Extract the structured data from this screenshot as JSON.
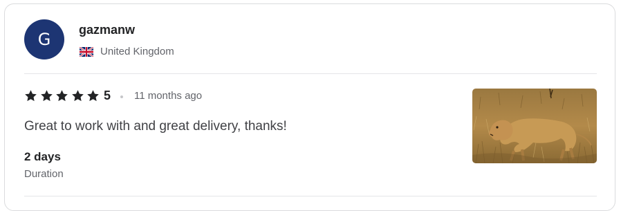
{
  "review": {
    "avatar_initial": "G",
    "username": "gazmanw",
    "country": "United Kingdom",
    "rating": "5",
    "stars_filled": 5,
    "time_ago": "11 months ago",
    "text": "Great to work with and great delivery, thanks!",
    "duration_value": "2 days",
    "duration_label": "Duration"
  },
  "icons": {
    "flag": "uk-flag-icon",
    "star": "star-icon"
  },
  "colors": {
    "avatar_bg": "#1d3573",
    "text_dark": "#222325",
    "text_muted": "#62646a"
  }
}
